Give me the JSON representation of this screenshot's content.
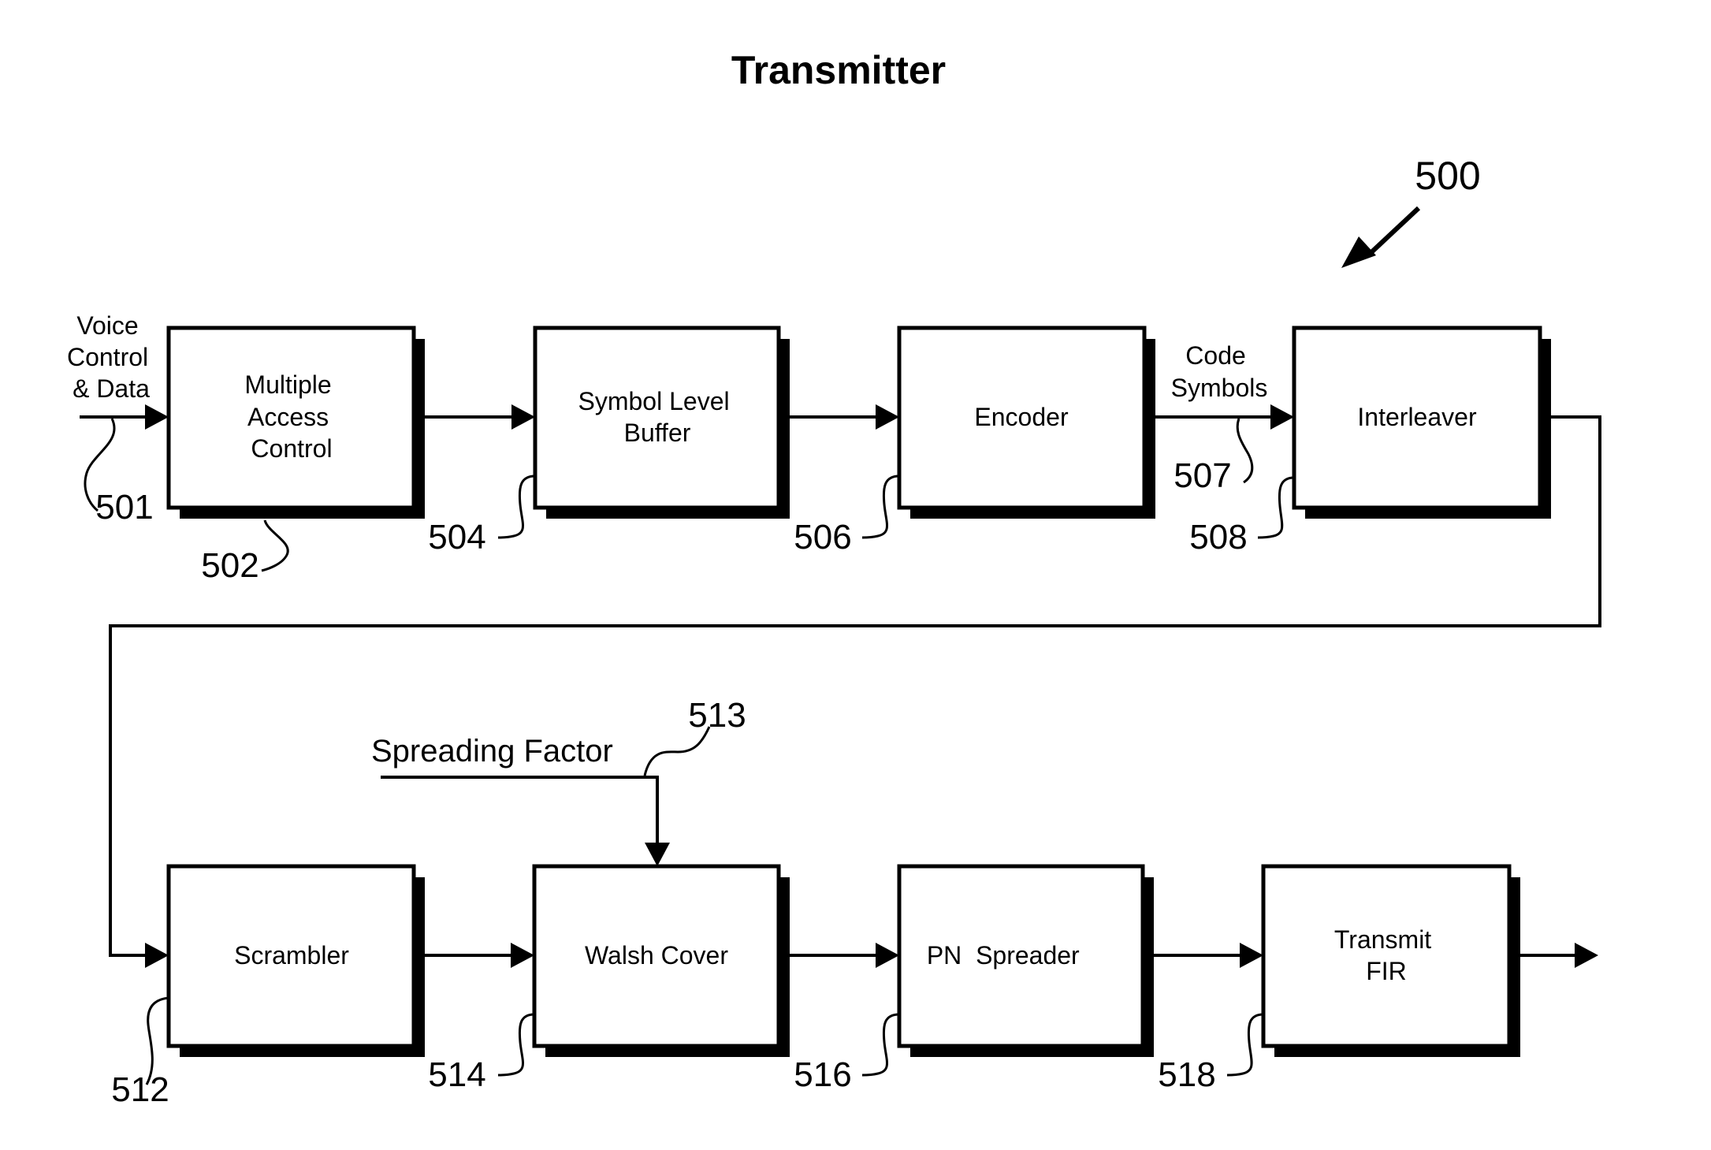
{
  "title": "Transmitter",
  "figure_ref": "500",
  "input_label": [
    "Voice",
    "Control",
    "& Data"
  ],
  "input_ref": "501",
  "code_symbols_label": [
    "Code",
    "Symbols"
  ],
  "code_symbols_ref": "507",
  "spreading_factor_label": "Spreading Factor",
  "spreading_factor_ref": "513",
  "blocks": [
    {
      "id": "multiple-access-control",
      "lines": [
        "Multiple",
        "Access",
        "Control"
      ],
      "ref": "502"
    },
    {
      "id": "symbol-level-buffer",
      "lines": [
        "Symbol Level",
        "Buffer"
      ],
      "ref": "504"
    },
    {
      "id": "encoder",
      "lines": [
        "Encoder"
      ],
      "ref": "506"
    },
    {
      "id": "interleaver",
      "lines": [
        "Interleaver"
      ],
      "ref": "508"
    },
    {
      "id": "scrambler",
      "lines": [
        "Scrambler"
      ],
      "ref": "512"
    },
    {
      "id": "walsh-cover",
      "lines": [
        "Walsh Cover"
      ],
      "ref": "514"
    },
    {
      "id": "pn-spreader",
      "lines": [
        "PN  Spreader"
      ],
      "ref": "516"
    },
    {
      "id": "transmit-fir",
      "lines": [
        "Transmit",
        "FIR"
      ],
      "ref": "518"
    }
  ]
}
